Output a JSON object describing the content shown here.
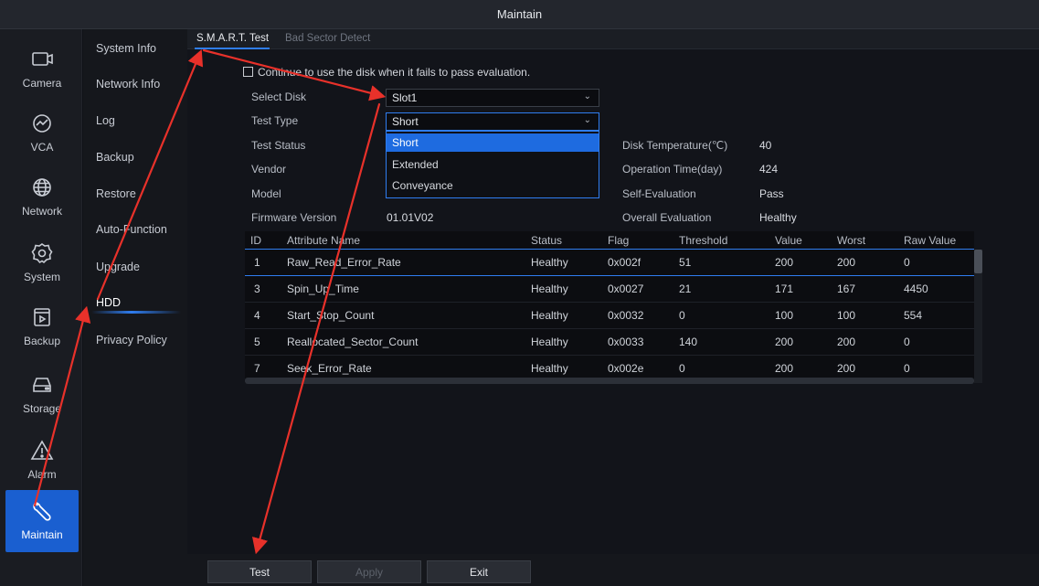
{
  "window": {
    "title": "Maintain"
  },
  "nav": [
    {
      "id": "camera",
      "label": "Camera",
      "icon": "camera-icon"
    },
    {
      "id": "vca",
      "label": "VCA",
      "icon": "vca-icon"
    },
    {
      "id": "network",
      "label": "Network",
      "icon": "globe-icon"
    },
    {
      "id": "system",
      "label": "System",
      "icon": "gear-icon"
    },
    {
      "id": "backup",
      "label": "Backup",
      "icon": "backup-icon"
    },
    {
      "id": "storage",
      "label": "Storage",
      "icon": "storage-icon"
    },
    {
      "id": "alarm",
      "label": "Alarm",
      "icon": "alarm-icon"
    },
    {
      "id": "maintain",
      "label": "Maintain",
      "icon": "wrench-icon",
      "active": true
    }
  ],
  "submenu": [
    "System Info",
    "Network Info",
    "Log",
    "Backup",
    "Restore",
    "Auto-Function",
    "Upgrade",
    "HDD",
    "Privacy Policy"
  ],
  "submenu_active": "HDD",
  "tabs": {
    "smart": "S.M.A.R.T. Test",
    "bad_sector": "Bad Sector Detect"
  },
  "form": {
    "continue_label": "Continue to use the disk when it fails to pass evaluation.",
    "select_disk_label": "Select Disk",
    "select_disk_value": "Slot1",
    "test_type_label": "Test Type",
    "test_type_value": "Short",
    "test_type_options": [
      "Short",
      "Extended",
      "Conveyance"
    ],
    "test_status_label": "Test Status",
    "vendor_label": "Vendor",
    "model_label": "Model",
    "firmware_label": "Firmware Version",
    "firmware_value": "01.01V02",
    "disk_temp_label": "Disk Temperature(℃)",
    "disk_temp_value": "40",
    "op_time_label": "Operation Time(day)",
    "op_time_value": "424",
    "self_eval_label": "Self-Evaluation",
    "self_eval_value": "Pass",
    "overall_eval_label": "Overall Evaluation",
    "overall_eval_value": "Healthy"
  },
  "table": {
    "headers": [
      "ID",
      "Attribute Name",
      "Status",
      "Flag",
      "Threshold",
      "Value",
      "Worst",
      "Raw Value"
    ],
    "rows": [
      [
        "1",
        "Raw_Read_Error_Rate",
        "Healthy",
        "0x002f",
        "51",
        "200",
        "200",
        "0"
      ],
      [
        "3",
        "Spin_Up_Time",
        "Healthy",
        "0x0027",
        "21",
        "171",
        "167",
        "4450"
      ],
      [
        "4",
        "Start_Stop_Count",
        "Healthy",
        "0x0032",
        "0",
        "100",
        "100",
        "554"
      ],
      [
        "5",
        "Reallocated_Sector_Count",
        "Healthy",
        "0x0033",
        "140",
        "200",
        "200",
        "0"
      ],
      [
        "7",
        "Seek_Error_Rate",
        "Healthy",
        "0x002e",
        "0",
        "200",
        "200",
        "0"
      ]
    ]
  },
  "buttons": {
    "test": "Test",
    "apply": "Apply",
    "exit": "Exit"
  },
  "colors": {
    "accent": "#2f7df0",
    "annotation_arrow": "#e8312a",
    "active_nav": "#1a5fd0"
  }
}
